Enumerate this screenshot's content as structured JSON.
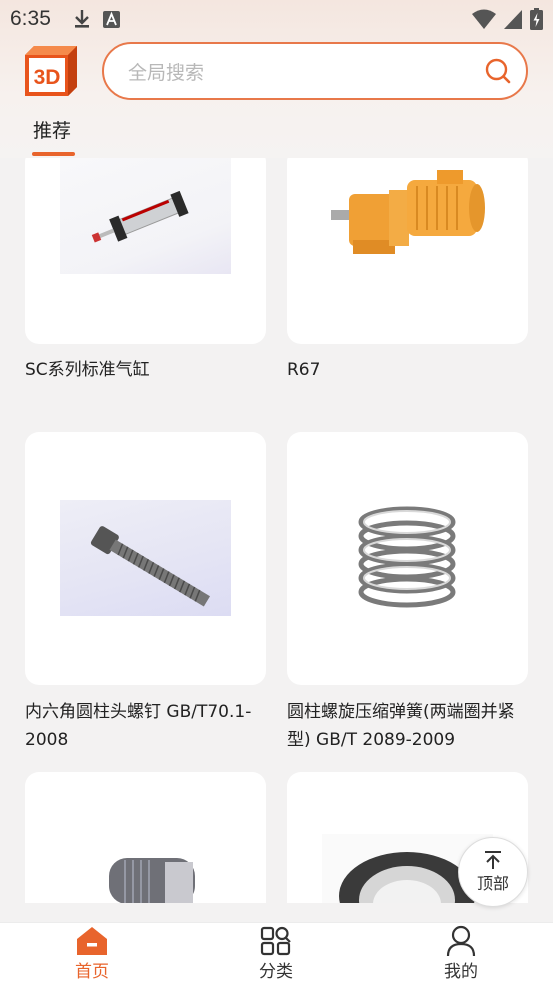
{
  "status_bar": {
    "time": "6:35"
  },
  "header": {
    "logo_text": "3D",
    "search_placeholder": "全局搜索"
  },
  "tabs": [
    {
      "label": "推荐",
      "active": true
    }
  ],
  "products": [
    {
      "title": "SC系列标准气缸"
    },
    {
      "title": "R67"
    },
    {
      "title": "内六角圆柱头螺钉 GB/T70.1-2008"
    },
    {
      "title": "圆柱螺旋压缩弹簧(两端圈并紧型) GB/T 2089-2009"
    },
    {
      "title": ""
    },
    {
      "title": ""
    }
  ],
  "back_to_top_label": "顶部",
  "bottom_nav": [
    {
      "label": "首页",
      "icon": "home-icon",
      "active": true
    },
    {
      "label": "分类",
      "icon": "category-icon",
      "active": false
    },
    {
      "label": "我的",
      "icon": "user-icon",
      "active": false
    }
  ],
  "colors": {
    "accent": "#e8642c",
    "search_border": "#e8784a"
  }
}
